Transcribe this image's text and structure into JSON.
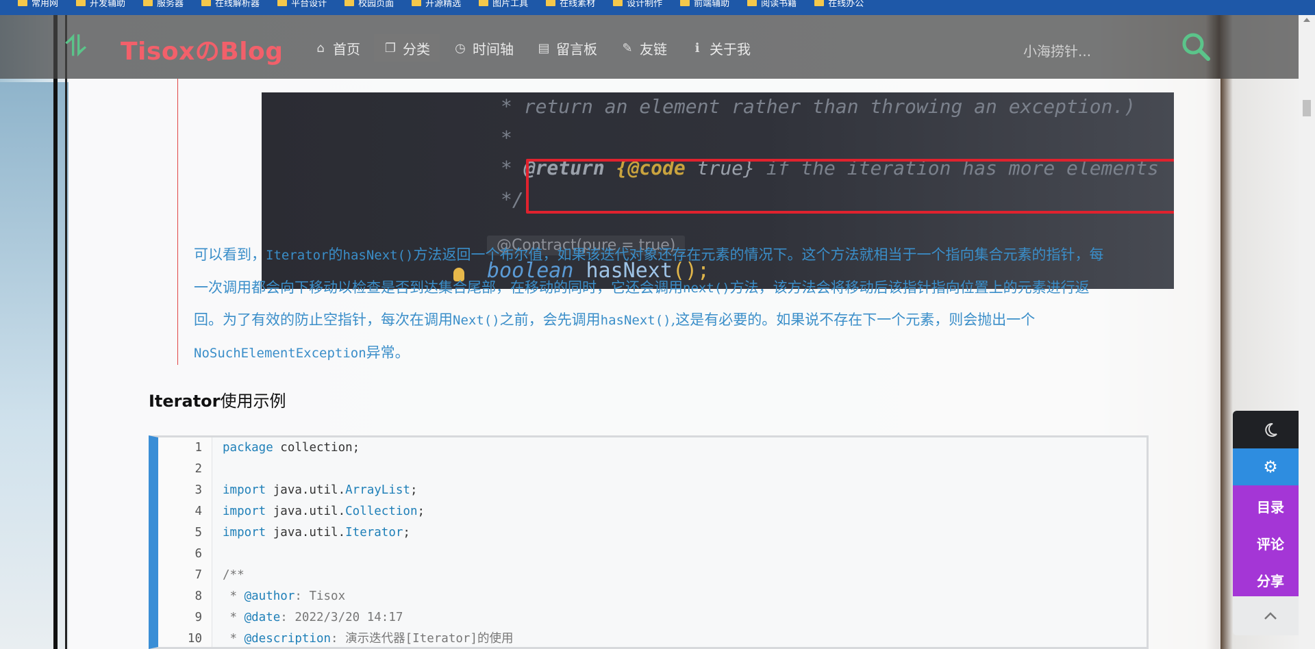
{
  "bookmarks": [
    {
      "label": "常用网"
    },
    {
      "label": "开发辅助"
    },
    {
      "label": "服务器"
    },
    {
      "label": "在线解析器"
    },
    {
      "label": "平台设计"
    },
    {
      "label": "校园页面"
    },
    {
      "label": "开源精选"
    },
    {
      "label": "图片工具"
    },
    {
      "label": "在线素材"
    },
    {
      "label": "设计制作"
    },
    {
      "label": "前端辅助"
    },
    {
      "label": "阅读书籍"
    },
    {
      "label": "在线办公"
    }
  ],
  "nav": {
    "logo_text": "TisoxのBlog",
    "items": [
      {
        "label": "首页",
        "icon": "home-icon"
      },
      {
        "label": "分类",
        "icon": "copy-icon"
      },
      {
        "label": "时间轴",
        "icon": "clock-icon"
      },
      {
        "label": "留言板",
        "icon": "book-icon"
      },
      {
        "label": "友链",
        "icon": "pencil-icon"
      },
      {
        "label": "关于我",
        "icon": "info-icon"
      }
    ],
    "search_text": "小海捞针...",
    "accent": "#5bc48a",
    "logo_color": "#f2606a"
  },
  "codeshot": {
    "line1": "* return an element rather than throwing an exception.)",
    "line2": "*",
    "line3_prefix": "* ",
    "line3_tag": "@return",
    "line3_code": "{@code",
    "line3_true": " true}",
    "line3_rest": " if the iteration has more elements",
    "line4": "*/",
    "contract": "@Contract(pure = true)",
    "decl_kw": "boolean",
    "decl_fn": "hasNext",
    "decl_rest": "();"
  },
  "para": {
    "s1": "可以看到，",
    "c1": "Iterator",
    "s2": "的",
    "c2": "hasNext()",
    "s3": "方法返回一个布尔值，如果该迭代对象还存在元素的情况下。这个方法就相当于一个指向集合元素的指针，每一次调用都会向下移动以检查是否到达集合尾部，在移动的同时，它还会调用",
    "c3": "next()",
    "s4": "方法，该方法会将移动后该指针指向位置上的元素进行返回。为了有效的防止空指针，每次在调用",
    "c4": "Next()",
    "s5": "之前，会先调用",
    "c5": "hasNext()",
    "s6": ",这是有必要的。如果说不存在下一个元素，则会抛出一个",
    "c6": "NoSuchElementException",
    "s7": "异常。"
  },
  "heading": {
    "bold": "Iterator",
    "rest": "使用示例"
  },
  "code_lines": [
    {
      "num": "1",
      "kw": "package",
      "rest": " collection;"
    },
    {
      "num": "2"
    },
    {
      "num": "3",
      "kw": "import",
      "pre": " java.util.",
      "cls": "ArrayList",
      "post": ";"
    },
    {
      "num": "4",
      "kw": "import",
      "pre": " java.util.",
      "cls": "Collection",
      "post": ";"
    },
    {
      "num": "5",
      "kw": "import",
      "pre": " java.util.",
      "cls": "Iterator",
      "post": ";"
    },
    {
      "num": "6"
    },
    {
      "num": "7",
      "com": "/**"
    },
    {
      "num": "8",
      "com": " * ",
      "tag": "@author",
      "post": ": Tisox"
    },
    {
      "num": "9",
      "com": " * ",
      "tag": "@date",
      "post": ": 2022/3/20 14:17"
    },
    {
      "num": "10",
      "com": " * ",
      "tag": "@description",
      "post": ": 演示迭代器[Iterator]的使用"
    }
  ],
  "float": {
    "dark_mode_icon": "moon-icon",
    "settings_icon": "gear-icon",
    "toc": "目录",
    "comments": "评论",
    "share": "分享",
    "top_icon": "chevron-up-icon",
    "colors": {
      "dark": "#1f2125",
      "blue": "#2e8de0",
      "purple": "#a436d6"
    }
  }
}
